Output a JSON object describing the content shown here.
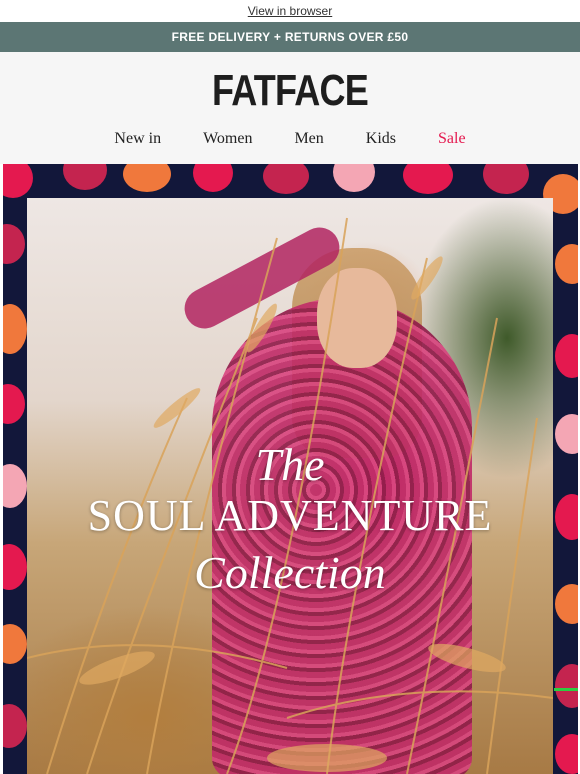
{
  "topbar": {
    "view_in_browser": "View in browser"
  },
  "promo": {
    "text": "FREE DELIVERY + RETURNS OVER £50",
    "bg_color": "#5c7674"
  },
  "header": {
    "logo": "FATFACE",
    "nav": [
      {
        "label": "New in"
      },
      {
        "label": "Women"
      },
      {
        "label": "Men"
      },
      {
        "label": "Kids"
      },
      {
        "label": "Sale",
        "color": "#e4194f"
      }
    ]
  },
  "hero": {
    "line1": "The",
    "line2": "SOUL ADVENTURE",
    "line3": "Collection",
    "frame_color": "#12173a",
    "flower_colors": [
      "#e4194f",
      "#f0783c",
      "#f4a6b4",
      "#c4244f"
    ]
  }
}
